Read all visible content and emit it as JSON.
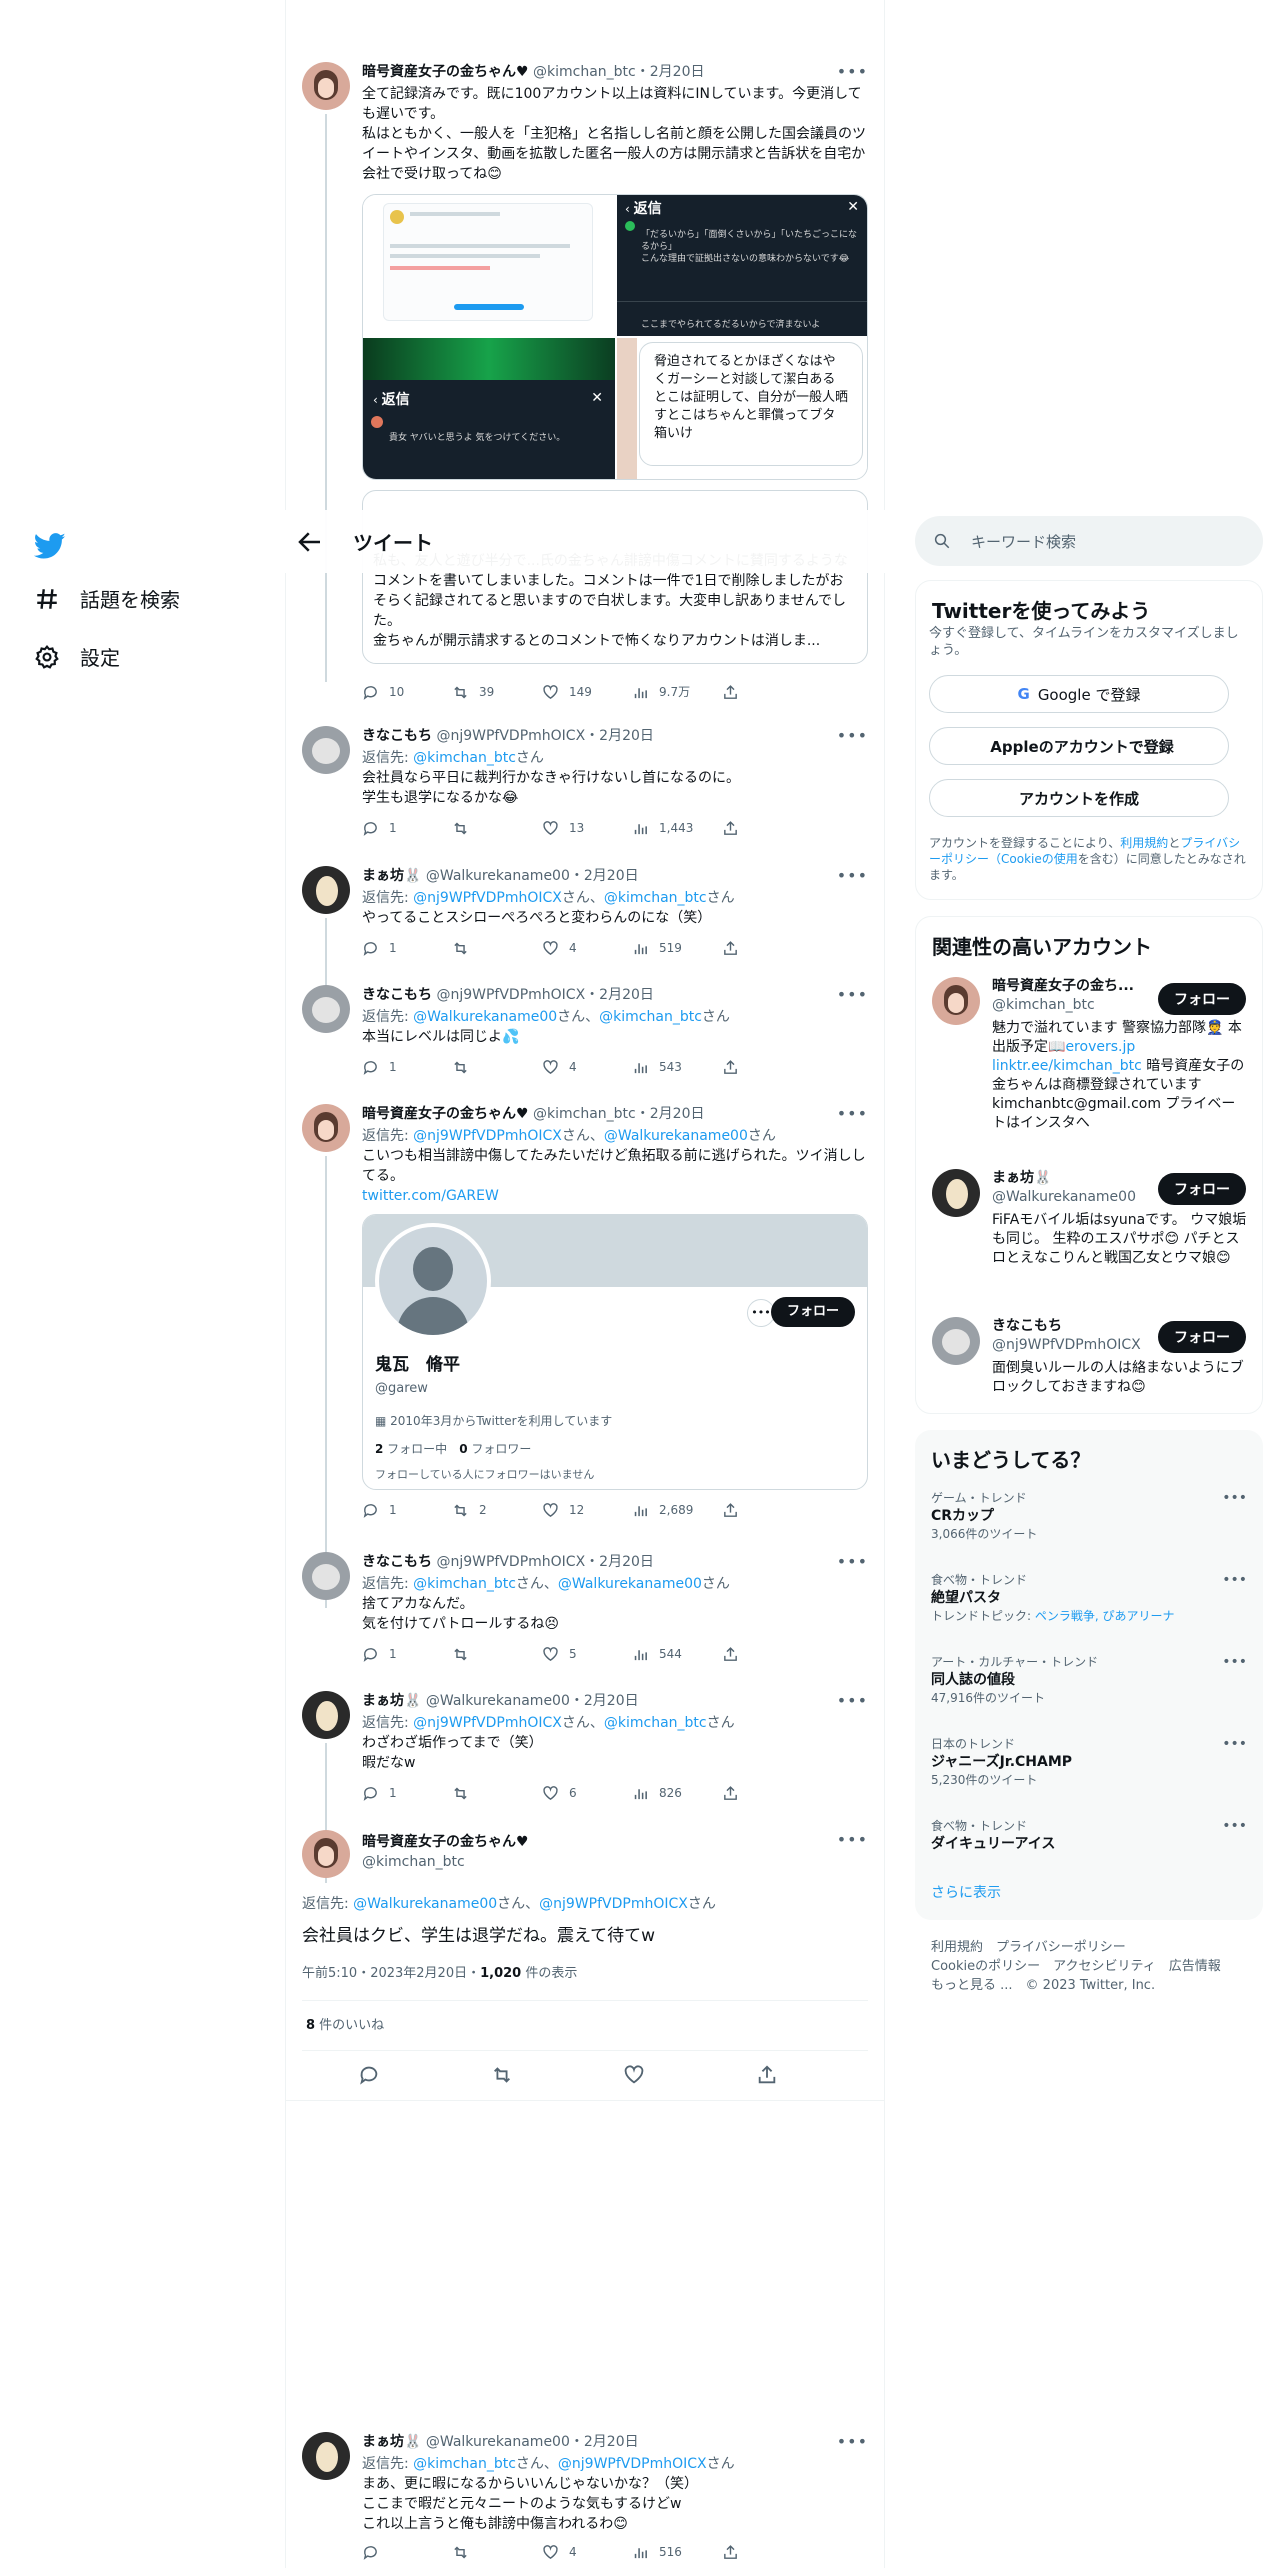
{
  "nav": {
    "explore": "話題を検索",
    "settings": "設定"
  },
  "header": {
    "title": "ツイート"
  },
  "tweet1": {
    "name": "暗号資産女子の金ちゃん♥",
    "handle": "@kimchan_btc",
    "time": "・2月20日",
    "text": "全て記録済みです。既に100アカウント以上は資料にINしています。今更消しても遅いです。\n私はともかく、一般人を「主犯格」と名指しし名前と顔を公開した国会議員のツイートやインスタ、動画を拡散した匿名一般人の方は開示請求と告訴状を自宅か会社で受け取ってね😊",
    "quote_text": "私も、友人と遊び半分で...氏の金ちゃん誹謗中傷コメントに賛同するようなコメントを書いてしまいました。コメントは一件で1日で削除しましたがおそらく記録されてると思いますので白状します。大変申し訳ありませんでした。\n金ちゃんが開示請求するとのコメントで怖くなりアカウントは消しま...",
    "img_reply_label": "返信",
    "img_reply_label2": "返信",
    "img_text": "脅迫されてるとかほざくなはやくガーシーと対談して潔白あるとこは証明して、自分が一般人晒すとこはちゃんと罪償ってブタ箱いけ",
    "img_c1": "「だるいから」「面倒くさいから」「いたちごっこになるから」",
    "img_c2": "こんな理由で証拠出さないの意味わからないです😂",
    "img_c3": "ここまでやられてるだるいからで済まないよ",
    "img_c4": "貴女 ヤバいと思うよ 気をつけてください。",
    "replies": "10",
    "retweets": "39",
    "likes": "149",
    "views": "9.7万"
  },
  "tweet2": {
    "name": "きなこもち",
    "handle": "@nj9WPfVDPmhOICX",
    "time": "・2月20日",
    "reply_prefix": "返信先: ",
    "reply_to": "@kimchan_btc",
    "reply_suffix": "さん",
    "text": "会社員なら平日に裁判行かなきゃ行けないし首になるのに。\n学生も退学になるかな😂",
    "replies": "1",
    "retweets": "",
    "likes": "13",
    "views": "1,443"
  },
  "tweet3": {
    "name": "まぁ坊🐰",
    "handle": "@Walkurekaname00",
    "time": "・2月20日",
    "reply_prefix": "返信先: ",
    "reply_to1": "@nj9WPfVDPmhOICX",
    "reply_mid": "さん、",
    "reply_to2": "@kimchan_btc",
    "reply_suffix": "さん",
    "text": "やってることスシローぺろぺろと変わらんのにな（笑）",
    "replies": "1",
    "retweets": "",
    "likes": "4",
    "views": "519"
  },
  "tweet4": {
    "name": "きなこもち",
    "handle": "@nj9WPfVDPmhOICX",
    "time": "・2月20日",
    "reply_prefix": "返信先: ",
    "reply_to1": "@Walkurekaname00",
    "reply_mid": "さん、",
    "reply_to2": "@kimchan_btc",
    "reply_suffix": "さん",
    "text": "本当にレベルは同じよ💦",
    "replies": "1",
    "retweets": "",
    "likes": "4",
    "views": "543"
  },
  "tweet5": {
    "name": "暗号資産女子の金ちゃん♥",
    "handle": "@kimchan_btc",
    "time": "・2月20日",
    "reply_prefix": "返信先: ",
    "reply_to1": "@nj9WPfVDPmhOICX",
    "reply_mid": "さん、",
    "reply_to2": "@Walkurekaname00",
    "reply_suffix": "さん",
    "text": "こいつも相当誹謗中傷してたみたいだけど魚拓取る前に逃げられた。ツイ消ししてる。",
    "link": "twitter.com/GAREW",
    "card_name": "鬼瓦　脩平",
    "card_handle": "@garew",
    "card_follow": "フォロー",
    "card_joined": "2010年3月からTwitterを利用しています",
    "card_following_n": "2",
    "card_following": " フォロー中",
    "card_followers_n": "0",
    "card_followers": " フォロワー",
    "card_note": "フォローしている人にフォロワーはいません",
    "replies": "1",
    "retweets": "2",
    "likes": "12",
    "views": "2,689"
  },
  "tweet6": {
    "name": "きなこもち",
    "handle": "@nj9WPfVDPmhOICX",
    "time": "・2月20日",
    "reply_prefix": "返信先: ",
    "reply_to1": "@kimchan_btc",
    "reply_mid": "さん、",
    "reply_to2": "@Walkurekaname00",
    "reply_suffix": "さん",
    "text": "捨てアカなんだ。\n気を付けてパトロールするね😣",
    "replies": "1",
    "retweets": "",
    "likes": "5",
    "views": "544"
  },
  "tweet7": {
    "name": "まぁ坊🐰",
    "handle": "@Walkurekaname00",
    "time": "・2月20日",
    "reply_prefix": "返信先: ",
    "reply_to1": "@nj9WPfVDPmhOICX",
    "reply_mid": "さん、",
    "reply_to2": "@kimchan_btc",
    "reply_suffix": "さん",
    "text": "わざわざ垢作ってまで（笑）\n暇だなw",
    "replies": "1",
    "retweets": "",
    "likes": "6",
    "views": "826"
  },
  "main_tweet": {
    "name": "暗号資産女子の金ちゃん♥",
    "handle": "@kimchan_btc",
    "reply_prefix": "返信先: ",
    "reply_to1": "@Walkurekaname00",
    "reply_mid": "さん、",
    "reply_to2": "@nj9WPfVDPmhOICX",
    "reply_suffix": "さん",
    "text": "会社員はクビ、学生は退学だね。震えて待てw",
    "meta": "午前5:10・2023年2月20日・",
    "views_n": "1,020",
    "views_label": " 件の表示",
    "likes_n": "8",
    "likes_label": " 件のいいね"
  },
  "tweet8": {
    "name": "まぁ坊🐰",
    "handle": "@Walkurekaname00",
    "time": "・2月20日",
    "reply_prefix": "返信先: ",
    "reply_to1": "@kimchan_btc",
    "reply_mid": "さん、",
    "reply_to2": "@nj9WPfVDPmhOICX",
    "reply_suffix": "さん",
    "text": "まあ、更に暇になるからいいんじゃないかな？（笑）\nここまで暇だと元々ニートのような気もするけどw\nこれ以上言うと俺も誹謗中傷言われるわ😊",
    "replies": "",
    "retweets": "",
    "likes": "4",
    "views": "516"
  },
  "search": {
    "placeholder": "キーワード検索"
  },
  "signup": {
    "title": "Twitterを使ってみよう",
    "subtitle": "今すぐ登録して、タイムラインをカスタマイズしましょう。",
    "google": "Google で登録",
    "apple": "Appleのアカウントで登録",
    "create": "アカウントを作成",
    "terms_pre": "アカウントを登録することにより、",
    "terms_link1": "利用規約",
    "terms_mid1": "と",
    "terms_link2": "プライバシーポリシー",
    "terms_link3": "（Cookieの使用",
    "terms_post": "を含む）に同意したとみなされます。"
  },
  "related": {
    "title": "関連性の高いアカウント",
    "follow": "フォロー",
    "accounts": [
      {
        "name": "暗号資産女子の金ち...",
        "handle": "@kimchan_btc",
        "bio": "魅力で溢れています 警察協力部隊👮 本出版予定📖",
        "link1": "erovers.jp",
        "link2": "linktr.ee/kimchan_btc",
        "bio2": " 暗号資産女子の金ちゃんは商標登録されています kimchanbtc@gmail.com プライベートはインスタへ"
      },
      {
        "name": "まぁ坊🐰",
        "handle": "@Walkurekaname00",
        "bio": "FiFAモバイル垢はsyunaです。 ウマ娘垢も同じ。 生粋のエスパサポ😊 パチとスロとえなこりんと戦国乙女とウマ娘😊"
      },
      {
        "name": "きなこもち",
        "handle": "@nj9WPfVDPmhOICX",
        "bio": "面倒臭いルールの人は絡まないようにブロックしておきますね😊"
      }
    ]
  },
  "trends": {
    "title": "いまどうしてる？",
    "items": [
      {
        "cat": "ゲーム・トレンド",
        "name": "CRカップ",
        "count": "3,066件のツイート"
      },
      {
        "cat": "食べ物・トレンド",
        "name": "絶望パスタ",
        "topic_prefix": "トレンドトピック: ",
        "topic": "ペンラ戦争, ぴあアリーナ"
      },
      {
        "cat": "アート・カルチャー・トレンド",
        "name": "同人誌の値段",
        "count": "47,916件のツイート"
      },
      {
        "cat": "日本のトレンド",
        "name": "ジャニーズJr.CHAMP",
        "count": "5,230件のツイート"
      },
      {
        "cat": "食べ物・トレンド",
        "name": "ダイキュリーアイス",
        "count": ""
      }
    ],
    "show_more": "さらに表示"
  },
  "footer": {
    "terms": "利用規約",
    "privacy": "プライバシーポリシー",
    "cookie": "Cookieのポリシー",
    "accessibility": "アクセシビリティ",
    "ads": "広告情報",
    "more": "もっと見る ...",
    "copyright": "© 2023 Twitter, Inc."
  },
  "colors": {
    "accent": "#1d9bf0",
    "text": "#0f1419",
    "secondary": "#536471",
    "border": "#eff3f4"
  }
}
